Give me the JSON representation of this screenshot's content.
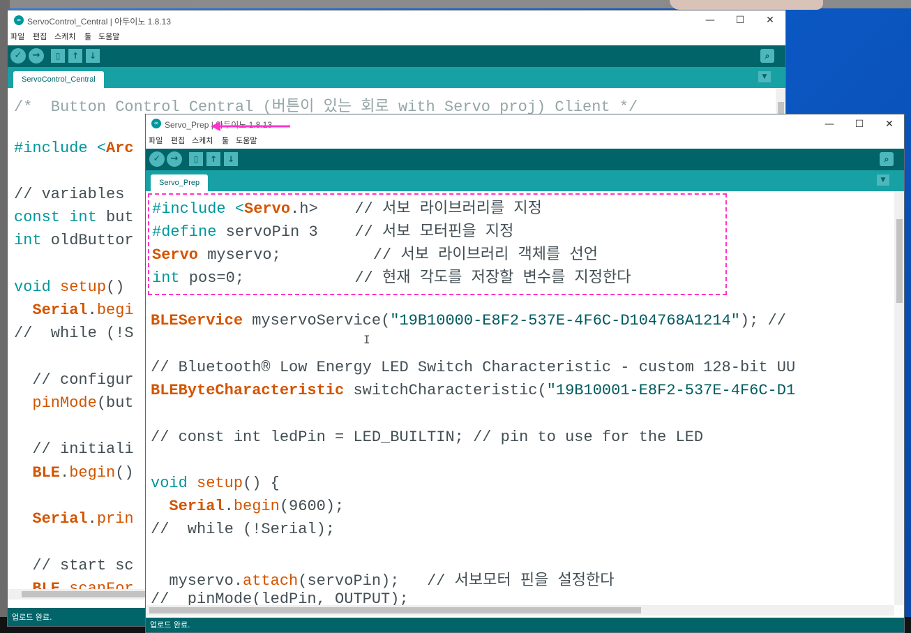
{
  "back_window": {
    "title": "ServoControl_Central | 아두이노 1.8.13",
    "menu": [
      "파일",
      "편집",
      "스케치",
      "툴",
      "도움말"
    ],
    "tab": "ServoControl_Central",
    "status": "업로드 완료.",
    "code": [
      "/*  Button Control Central (버튼이 있는 회로 with Servo proj) Client */",
      "",
      "#include <Arc",
      "",
      "// variables",
      "const int but",
      "int oldButtor",
      "",
      "void setup()",
      "  Serial.begi",
      "//  while (!S",
      "",
      "  // configur",
      "  pinMode(but",
      "",
      "  // initiali",
      "  BLE.begin()",
      "",
      "  Serial.prin",
      "",
      "  // start sc",
      "  BLE.scanFor"
    ]
  },
  "front_window": {
    "title": "Servo_Prep | 아두이노 1.8.13",
    "menu": [
      "파일",
      "편집",
      "스케치",
      "툴",
      "도움말"
    ],
    "tab": "Servo_Prep",
    "status": "업로드 완료.",
    "code": [
      "#include <Servo.h>    // 서보 라이브러리를 지정",
      "#define servoPin 3    // 서보 모터핀을 지정",
      "Servo myservo;          // 서보 라이브러리 객체를 선언",
      "int pos=0;            // 현재 각도를 저장할 변수를 지정한다",
      "",
      "BLEService myservoService(\"19B10000-E8F2-537E-4F6C-D104768A1214\"); //",
      "",
      "// Bluetooth® Low Energy LED Switch Characteristic - custom 128-bit UU",
      "BLEByteCharacteristic switchCharacteristic(\"19B10001-E8F2-537E-4F6C-D1",
      "",
      "// const int ledPin = LED_BUILTIN; // pin to use for the LED",
      "",
      "void setup() {",
      "  Serial.begin(9600);",
      "//  while (!Serial);",
      "",
      "  myservo.attach(servoPin);   // 서보모터 핀을 설정한다",
      "//  pinMode(ledPin, OUTPUT);"
    ]
  },
  "window_controls": {
    "minimize": "—",
    "maximize": "☐",
    "close": "✕"
  },
  "icons": [
    "verify-icon",
    "upload-icon",
    "new-icon",
    "open-icon",
    "save-icon",
    "serial-monitor-icon",
    "tab-menu-icon"
  ],
  "colors": {
    "teal_dark": "#006468",
    "teal": "#17a1a5",
    "annotation": "#ff33cc"
  }
}
